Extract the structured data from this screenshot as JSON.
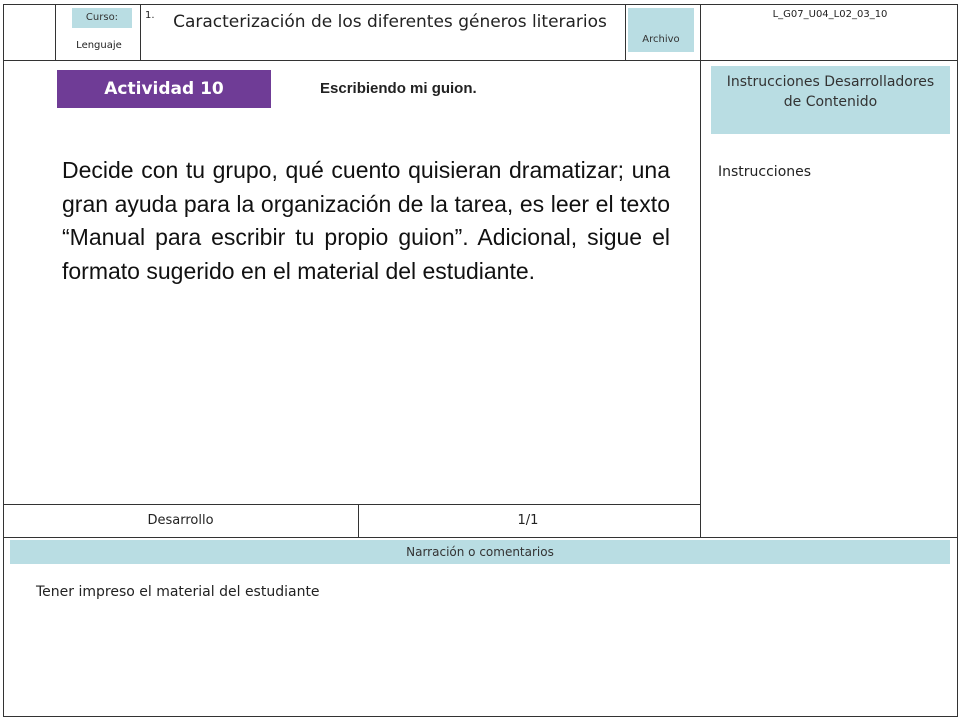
{
  "header": {
    "course_label": "Curso:",
    "course_value": "Lenguaje",
    "number": "1.",
    "title": "Caracterización de los diferentes géneros literarios",
    "archive_label": "Archivo",
    "file_code": "L_G07_U04_L02_03_10"
  },
  "activity": {
    "badge": "Actividad 10",
    "subtitle": "Escribiendo mi guion.",
    "body": "Decide con tu grupo, qué cuento quisieran dramatizar; una gran ayuda para la organización de la tarea, es leer el texto “Manual para escribir tu propio guion”. Adicional, sigue el formato sugerido en el material del estudiante."
  },
  "sidebar": {
    "header": "Instrucciones Desarrolladores de Contenido",
    "label": "Instrucciones"
  },
  "footer_bar": {
    "section": "Desarrollo",
    "page": "1/1"
  },
  "narration": {
    "header": "Narración o comentarios",
    "text": "Tener impreso el material del estudiante"
  },
  "colors": {
    "accent_purple": "#6f3c96",
    "teal": "#b9dde3",
    "border": "#333333"
  }
}
